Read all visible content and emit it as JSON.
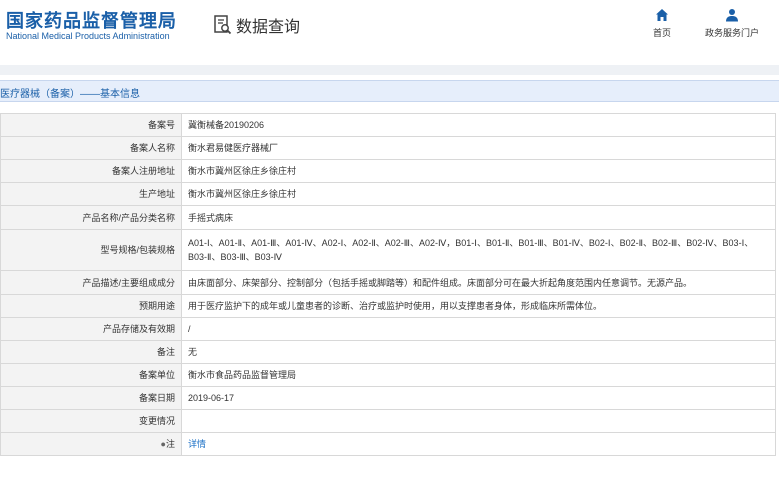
{
  "header": {
    "brand_cn": "国家药品监督管理局",
    "brand_en": "National Medical Products Administration",
    "search_title": "数据查询",
    "nav": [
      {
        "label": "首页",
        "icon": "home-icon"
      },
      {
        "label": "政务服务门户",
        "icon": "user-icon"
      }
    ]
  },
  "breadcrumb": "医疗器械（备案）——基本信息",
  "rows": [
    {
      "label": "备案号",
      "value": "冀衡械备20190206"
    },
    {
      "label": "备案人名称",
      "value": "衡水君易健医疗器械厂"
    },
    {
      "label": "备案人注册地址",
      "value": "衡水市冀州区徐庄乡徐庄村"
    },
    {
      "label": "生产地址",
      "value": "衡水市冀州区徐庄乡徐庄村"
    },
    {
      "label": "产品名称/产品分类名称",
      "value": "手摇式病床"
    },
    {
      "label": "型号规格/包装规格",
      "value": "A01-Ⅰ、A01-Ⅱ、A01-Ⅲ、A01-Ⅳ、A02-Ⅰ、A02-Ⅱ、A02-Ⅲ、A02-Ⅳ，B01-Ⅰ、B01-Ⅱ、B01-Ⅲ、B01-Ⅳ、B02-Ⅰ、B02-Ⅱ、B02-Ⅲ、B02-Ⅳ、B03-Ⅰ、B03-Ⅱ、B03-Ⅲ、B03-Ⅳ"
    },
    {
      "label": "产品描述/主要组成成分",
      "value": "由床面部分、床架部分、控制部分（包括手摇或脚踏等）和配件组成。床面部分可在最大折起角度范围内任意调节。无源产品。"
    },
    {
      "label": "预期用途",
      "value": "用于医疗监护下的成年或儿童患者的诊断、治疗或监护时使用，用以支撑患者身体，形成临床所需体位。"
    },
    {
      "label": "产品存储及有效期",
      "value": "/"
    },
    {
      "label": "备注",
      "value": "无"
    },
    {
      "label": "备案单位",
      "value": "衡水市食品药品监督管理局"
    },
    {
      "label": "备案日期",
      "value": "2019-06-17"
    },
    {
      "label": "变更情况",
      "value": ""
    }
  ],
  "note_row": {
    "label": "注",
    "link": "详情"
  }
}
